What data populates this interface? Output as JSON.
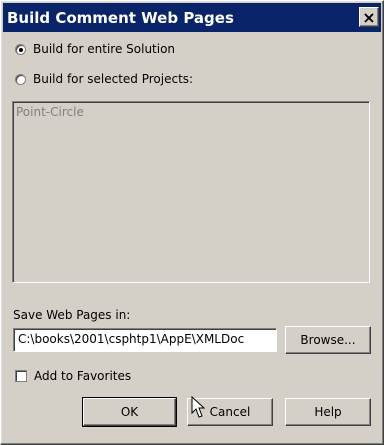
{
  "window": {
    "title": "Build Comment Web Pages",
    "close_label": "×"
  },
  "options": {
    "entire_solution_label": "Build for entire Solution",
    "entire_solution_selected": true,
    "selected_projects_label": "Build for selected Projects:",
    "selected_projects_selected": false
  },
  "projects": {
    "items": [
      "Point-Circle"
    ]
  },
  "save": {
    "label": "Save Web Pages in:",
    "path_value": "C:\\books\\2001\\csphtp1\\AppE\\XMLDoc",
    "browse_label": "Browse..."
  },
  "favorites": {
    "label": "Add to Favorites",
    "checked": false
  },
  "buttons": {
    "ok_label": "OK",
    "cancel_label": "Cancel",
    "help_label": "Help"
  }
}
